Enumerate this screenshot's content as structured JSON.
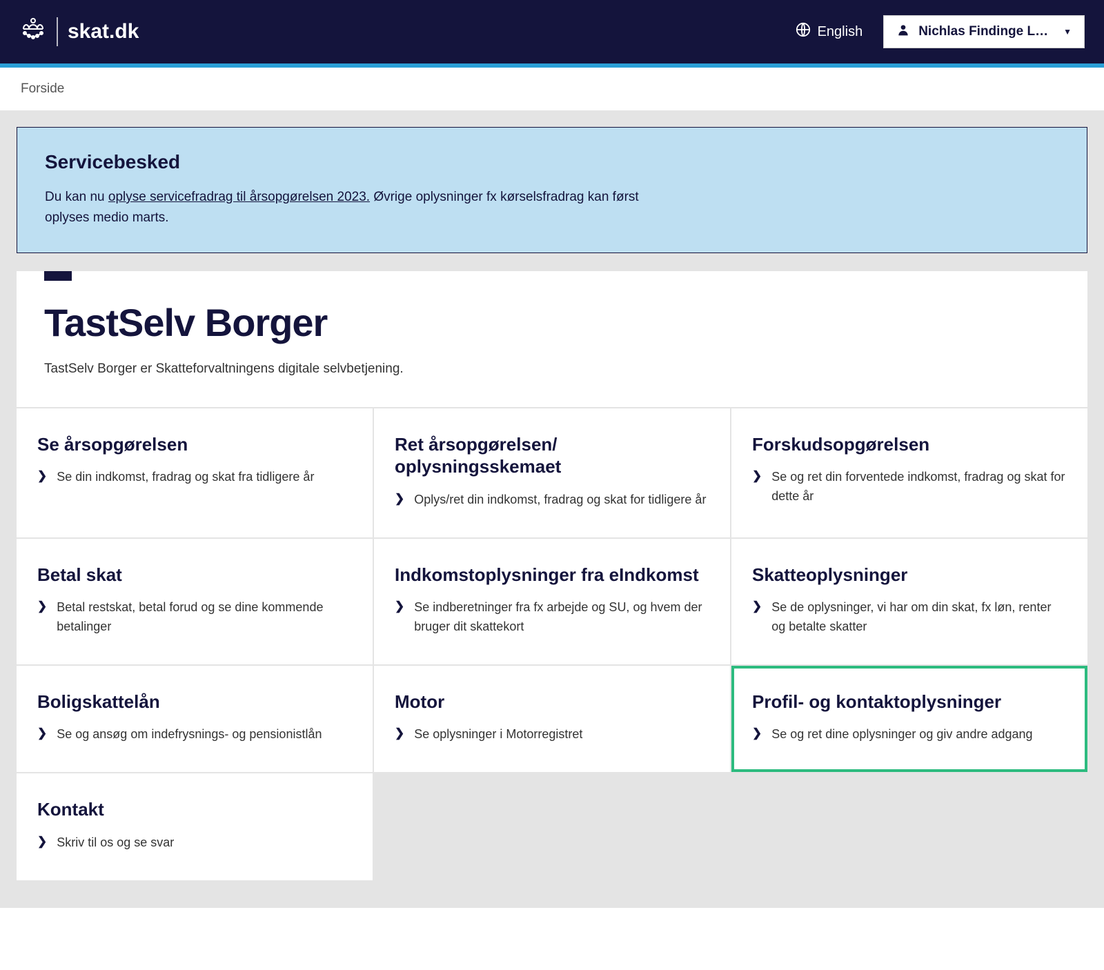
{
  "header": {
    "logo_text": "skat.dk",
    "language_label": "English",
    "user_name": "Nichlas Findinge L…"
  },
  "breadcrumb": {
    "home": "Forside"
  },
  "notice": {
    "title": "Servicebesked",
    "text_before": "Du kan nu ",
    "link": "oplyse servicefradrag til årsopgørelsen 2023.",
    "text_after": " Øvrige oplysninger fx kørselsfradrag kan først oplyses medio marts."
  },
  "main": {
    "title": "TastSelv Borger",
    "subtitle": "TastSelv Borger er Skatteforvaltningens digitale selvbetjening."
  },
  "tiles": [
    {
      "title": "Se årsopgørelsen",
      "desc": "Se din indkomst, fradrag og skat fra tidligere år"
    },
    {
      "title": "Ret årsopgørelsen/ oplysningsskemaet",
      "desc": "Oplys/ret din indkomst, fradrag og skat for tidligere år"
    },
    {
      "title": "Forskudsopgørelsen",
      "desc": "Se og ret din forventede indkomst, fradrag og skat for dette år"
    },
    {
      "title": "Betal skat",
      "desc": "Betal restskat, betal forud og se dine kommende betalinger"
    },
    {
      "title": "Indkomstoplysninger fra eIndkomst",
      "desc": "Se indberetninger fra fx arbejde og SU, og hvem der bruger dit skattekort"
    },
    {
      "title": "Skatteoplysninger",
      "desc": "Se de oplysninger, vi har om din skat, fx løn, renter og betalte skatter"
    },
    {
      "title": "Boligskattelån",
      "desc": "Se og ansøg om indefrysnings- og pensionistlån"
    },
    {
      "title": "Motor",
      "desc": "Se oplysninger i Motorregistret"
    },
    {
      "title": "Profil- og kontaktoplysninger",
      "desc": "Se og ret dine oplysninger og giv andre adgang",
      "highlight": true
    },
    {
      "title": "Kontakt",
      "desc": "Skriv til os og se svar"
    }
  ]
}
